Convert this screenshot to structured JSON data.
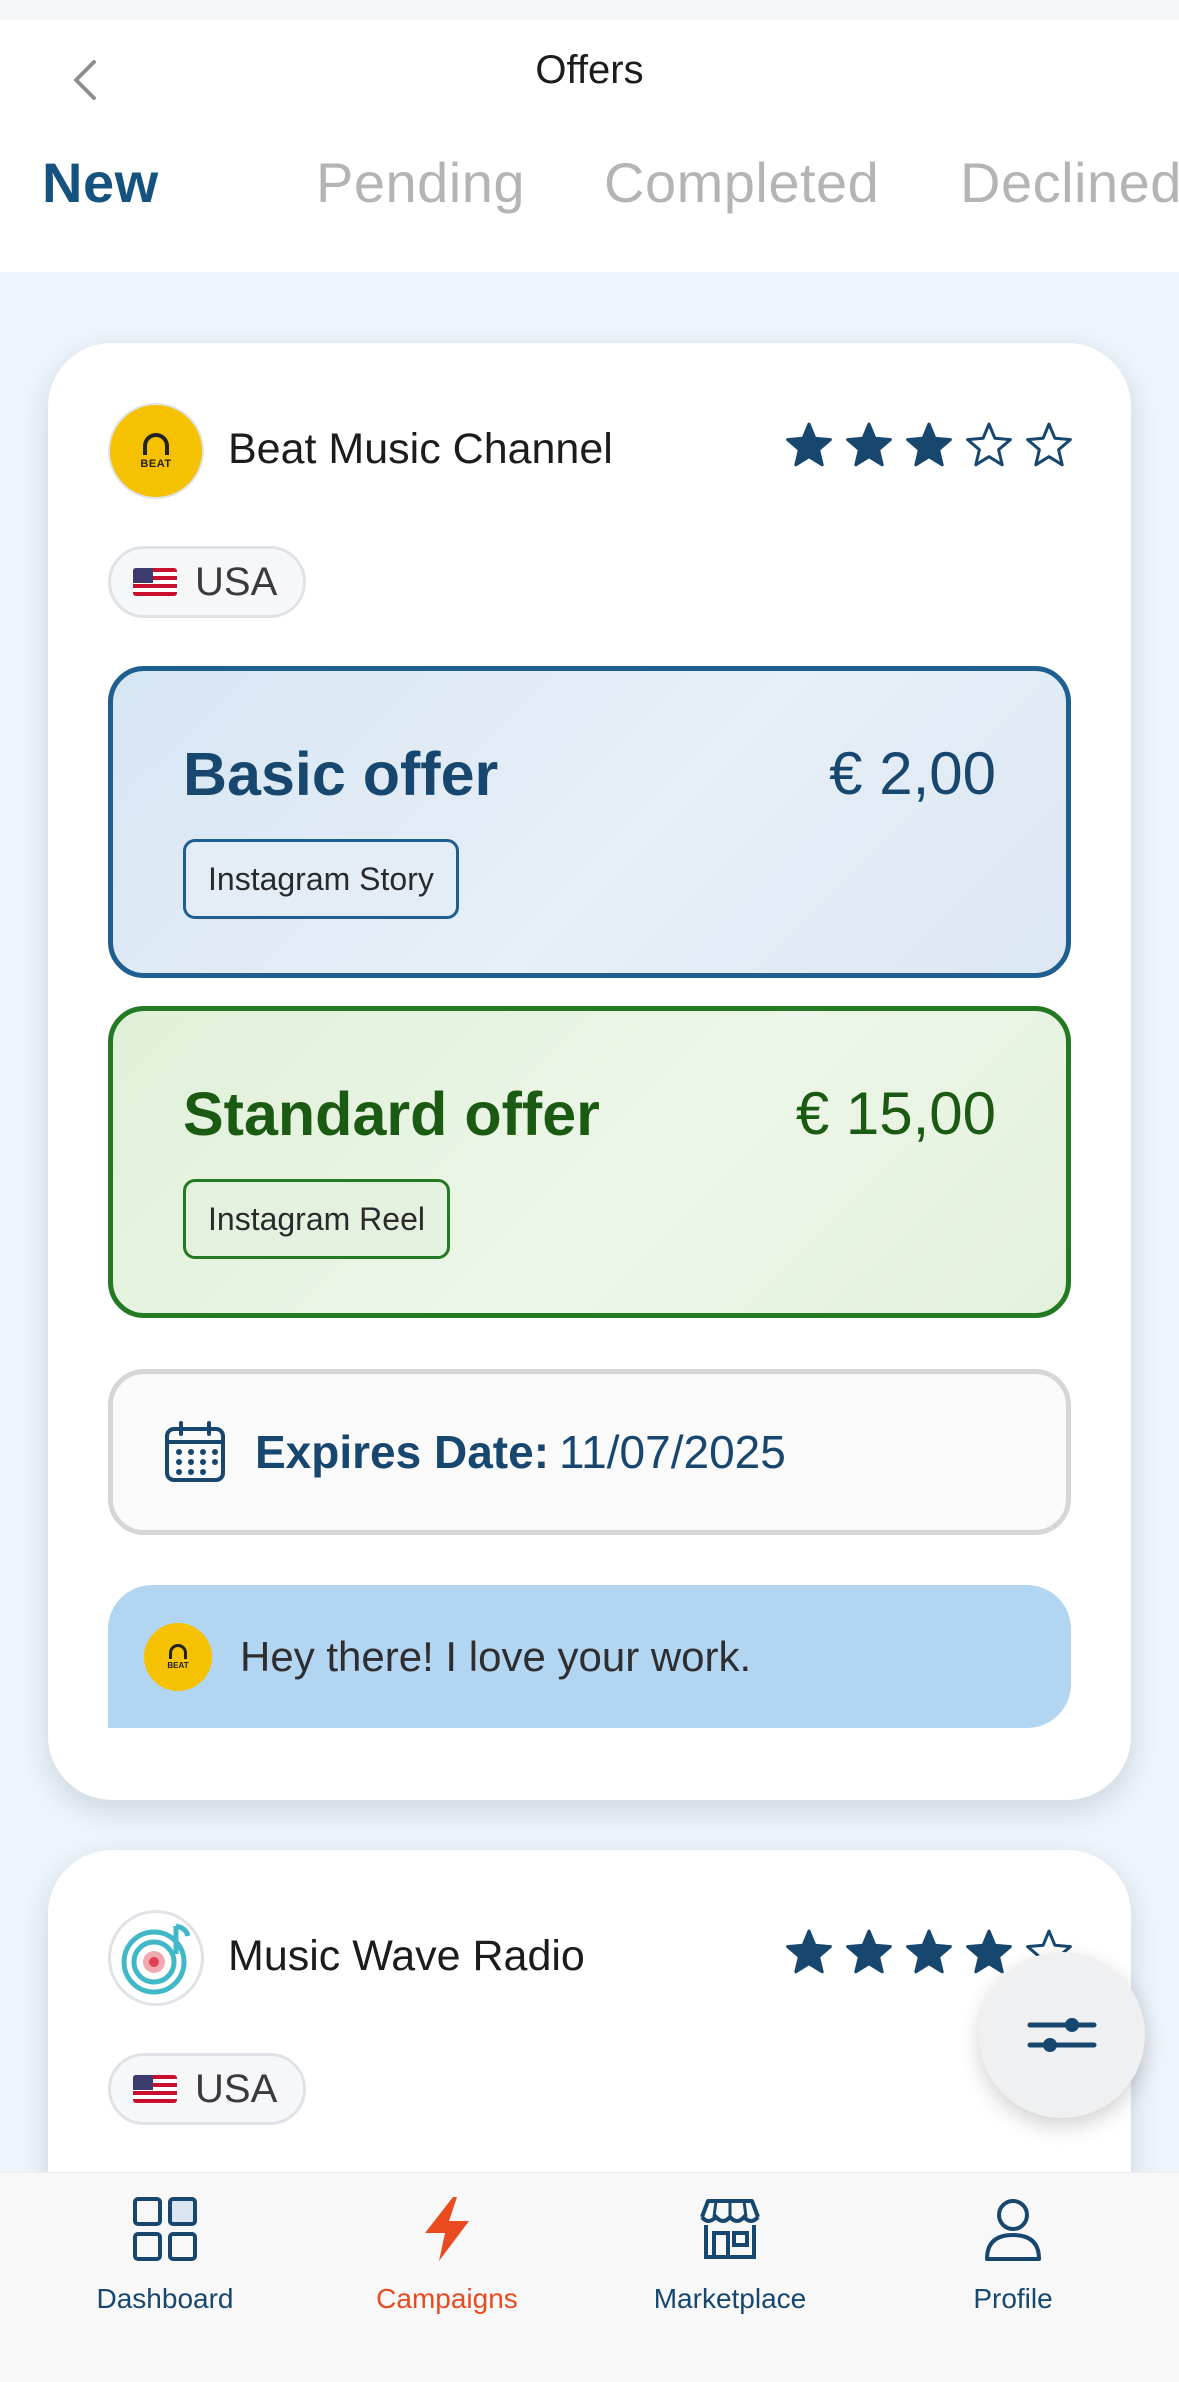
{
  "header": {
    "title": "Offers",
    "back_icon": "chevron-left-icon"
  },
  "tabs": [
    {
      "label": "New",
      "active": true
    },
    {
      "label": "Pending",
      "active": false
    },
    {
      "label": "Completed",
      "active": false
    },
    {
      "label": "Declined",
      "active": false
    }
  ],
  "cards": [
    {
      "channel_name": "Beat Music Channel",
      "avatar_text": "BEAT",
      "rating": 3,
      "rating_max": 5,
      "country": "USA",
      "offers": [
        {
          "title": "Basic offer",
          "price": "€ 2,00",
          "format": "Instagram Story"
        },
        {
          "title": "Standard offer",
          "price": "€ 15,00",
          "format": "Instagram Reel"
        }
      ],
      "expires_label": "Expires Date:",
      "expires_value": "11/07/2025",
      "message": "Hey there! I love your work."
    },
    {
      "channel_name": "Music Wave Radio",
      "rating": 4,
      "rating_max": 5,
      "country": "USA"
    }
  ],
  "fab": {
    "icon": "filter-sliders-icon"
  },
  "bottom_nav": [
    {
      "label": "Dashboard",
      "icon": "dashboard-grid-icon",
      "active": false
    },
    {
      "label": "Campaigns",
      "icon": "lightning-bolt-icon",
      "active": true
    },
    {
      "label": "Marketplace",
      "icon": "storefront-icon",
      "active": false
    },
    {
      "label": "Profile",
      "icon": "user-icon",
      "active": false
    }
  ],
  "colors": {
    "primary": "#17476e",
    "accent": "#ea4a1f",
    "basic_border": "#1f5f8f",
    "standard_border": "#237a23",
    "message_bg": "#b2d6f2",
    "avatar_yellow": "#f6c100"
  }
}
